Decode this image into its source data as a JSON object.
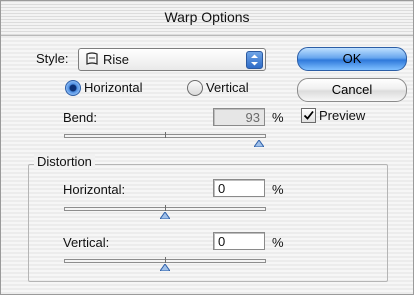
{
  "window": {
    "title": "Warp Options"
  },
  "style": {
    "label": "Style:",
    "selected": "Rise",
    "icon": "warp-doc-icon"
  },
  "orientation": {
    "horizontal": "Horizontal",
    "vertical": "Vertical",
    "selected": "Horizontal"
  },
  "bend": {
    "label": "Bend:",
    "value": "93",
    "unit": "%",
    "level_percent": 93
  },
  "buttons": {
    "ok": "OK",
    "cancel": "Cancel"
  },
  "preview": {
    "label": "Preview",
    "checked": true
  },
  "distortion": {
    "title": "Distortion",
    "horizontal": {
      "label": "Horizontal:",
      "value": "0",
      "unit": "%",
      "level_percent": 0
    },
    "vertical": {
      "label": "Vertical:",
      "value": "0",
      "unit": "%",
      "level_percent": 0
    }
  }
}
